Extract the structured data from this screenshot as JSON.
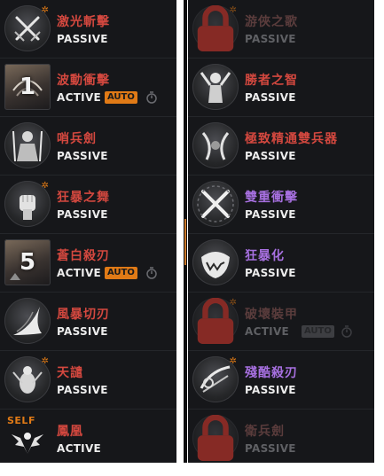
{
  "left_skills": [
    {
      "name": "激光斬擊",
      "type": "PASSIVE",
      "icon": "crossed-swords-icon"
    },
    {
      "name": "波動衝擊",
      "type": "ACTIVE",
      "auto": "AUTO",
      "icon": "impact-wave-icon",
      "level": "1"
    },
    {
      "name": "哨兵劍",
      "type": "PASSIVE",
      "icon": "sentinel-icon"
    },
    {
      "name": "狂暴之舞",
      "type": "PASSIVE",
      "icon": "fist-icon"
    },
    {
      "name": "蒼白殺刃",
      "type": "ACTIVE",
      "auto": "AUTO",
      "icon": "pale-blade-icon",
      "level": "5"
    },
    {
      "name": "風暴切刃",
      "type": "PASSIVE",
      "icon": "storm-blade-icon"
    },
    {
      "name": "天譴",
      "type": "PASSIVE",
      "icon": "nemesis-icon"
    },
    {
      "name": "鳳凰",
      "type": "ACTIVE",
      "icon": "phoenix-icon",
      "badge": "SELF"
    }
  ],
  "right_skills": [
    {
      "name": "游俠之歌",
      "type": "PASSIVE",
      "icon": "lock-icon",
      "locked": true
    },
    {
      "name": "勝者之智",
      "type": "PASSIVE",
      "icon": "victor-icon"
    },
    {
      "name": "極致精通雙兵器",
      "type": "PASSIVE",
      "icon": "dual-weapon-icon"
    },
    {
      "name": "雙重衝擊",
      "type": "PASSIVE",
      "icon": "double-strike-icon"
    },
    {
      "name": "狂暴化",
      "type": "PASSIVE",
      "icon": "berserk-icon"
    },
    {
      "name": "破壞裝甲",
      "type": "ACTIVE",
      "auto": "AUTO",
      "icon": "lock-icon",
      "locked": true
    },
    {
      "name": "殘酷殺刃",
      "type": "PASSIVE",
      "icon": "cruel-blade-icon"
    },
    {
      "name": "衛兵劍",
      "type": "PASSIVE",
      "icon": "lock-icon",
      "locked": true
    }
  ],
  "colors": {
    "name_red": "#d4483f",
    "name_purple": "#a770e0",
    "auto_orange": "#e07a16",
    "panel_bg": "#16171a"
  }
}
